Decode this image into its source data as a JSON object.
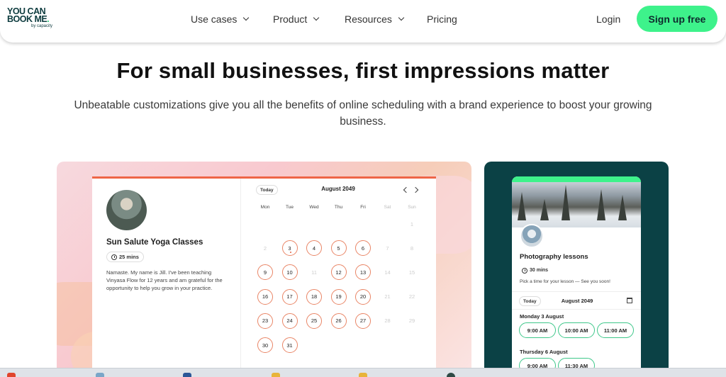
{
  "header": {
    "logo": {
      "line1": "YOU CAN",
      "line2": "BOOK ME",
      "dot": ".",
      "tagline": "by capacity"
    },
    "nav": [
      {
        "label": "Use cases",
        "has_dropdown": true
      },
      {
        "label": "Product",
        "has_dropdown": true
      },
      {
        "label": "Resources",
        "has_dropdown": true
      },
      {
        "label": "Pricing",
        "has_dropdown": false
      }
    ],
    "login": "Login",
    "signup": "Sign up free"
  },
  "hero": {
    "title": "For small businesses, first impressions matter",
    "subtitle": "Unbeatable customizations give you all the benefits of online scheduling with a brand experience to boost your growing business."
  },
  "yoga_card": {
    "title": "Sun Salute Yoga Classes",
    "duration": "25 mins",
    "description": "Namaste. My name is Jill. I've been teaching Vinyasa Flow for 12 years and am grateful for the opportunity to help you grow in your practice.",
    "today": "Today",
    "month": "August 2049",
    "weekdays": [
      "Mon",
      "Tue",
      "Wed",
      "Thu",
      "Fri",
      "Sat",
      "Sun"
    ],
    "days": [
      {
        "n": "1",
        "col": 7,
        "row": 0,
        "available": false
      },
      {
        "n": "2",
        "col": 1,
        "row": 1,
        "available": false
      },
      {
        "n": "3",
        "col": 2,
        "row": 1,
        "available": true,
        "marked": true
      },
      {
        "n": "4",
        "col": 3,
        "row": 1,
        "available": true
      },
      {
        "n": "5",
        "col": 4,
        "row": 1,
        "available": true
      },
      {
        "n": "6",
        "col": 5,
        "row": 1,
        "available": true
      },
      {
        "n": "7",
        "col": 6,
        "row": 1,
        "available": false
      },
      {
        "n": "8",
        "col": 7,
        "row": 1,
        "available": false
      },
      {
        "n": "9",
        "col": 1,
        "row": 2,
        "available": true
      },
      {
        "n": "10",
        "col": 2,
        "row": 2,
        "available": true
      },
      {
        "n": "11",
        "col": 3,
        "row": 2,
        "available": false
      },
      {
        "n": "12",
        "col": 4,
        "row": 2,
        "available": true
      },
      {
        "n": "13",
        "col": 5,
        "row": 2,
        "available": true
      },
      {
        "n": "14",
        "col": 6,
        "row": 2,
        "available": false
      },
      {
        "n": "15",
        "col": 7,
        "row": 2,
        "available": false
      },
      {
        "n": "16",
        "col": 1,
        "row": 3,
        "available": true
      },
      {
        "n": "17",
        "col": 2,
        "row": 3,
        "available": true
      },
      {
        "n": "18",
        "col": 3,
        "row": 3,
        "available": true
      },
      {
        "n": "19",
        "col": 4,
        "row": 3,
        "available": true
      },
      {
        "n": "20",
        "col": 5,
        "row": 3,
        "available": true
      },
      {
        "n": "21",
        "col": 6,
        "row": 3,
        "available": false
      },
      {
        "n": "22",
        "col": 7,
        "row": 3,
        "available": false
      },
      {
        "n": "23",
        "col": 1,
        "row": 4,
        "available": true
      },
      {
        "n": "24",
        "col": 2,
        "row": 4,
        "available": true
      },
      {
        "n": "25",
        "col": 3,
        "row": 4,
        "available": true
      },
      {
        "n": "26",
        "col": 4,
        "row": 4,
        "available": true
      },
      {
        "n": "27",
        "col": 5,
        "row": 4,
        "available": true
      },
      {
        "n": "28",
        "col": 6,
        "row": 4,
        "available": false
      },
      {
        "n": "29",
        "col": 7,
        "row": 4,
        "available": false
      },
      {
        "n": "30",
        "col": 1,
        "row": 5,
        "available": true
      },
      {
        "n": "31",
        "col": 2,
        "row": 5,
        "available": true
      }
    ]
  },
  "photo_card": {
    "title": "Photography lessons",
    "duration": "30 mins",
    "description": "Pick a time for your lesson — See you soon!",
    "today": "Today",
    "month": "August 2049",
    "day_groups": [
      {
        "label": "Monday 3 August",
        "slots": [
          "9:00 AM",
          "10:00 AM",
          "11:00 AM"
        ]
      },
      {
        "label": "Thursday 6 August",
        "slots": [
          "9:00 AM",
          "11:30 AM"
        ]
      }
    ]
  },
  "colors": {
    "accent_green": "#3ef28b",
    "brand_dark": "#0d3b3e",
    "teal_panel": "#0b4145",
    "coral": "#ee6547"
  }
}
